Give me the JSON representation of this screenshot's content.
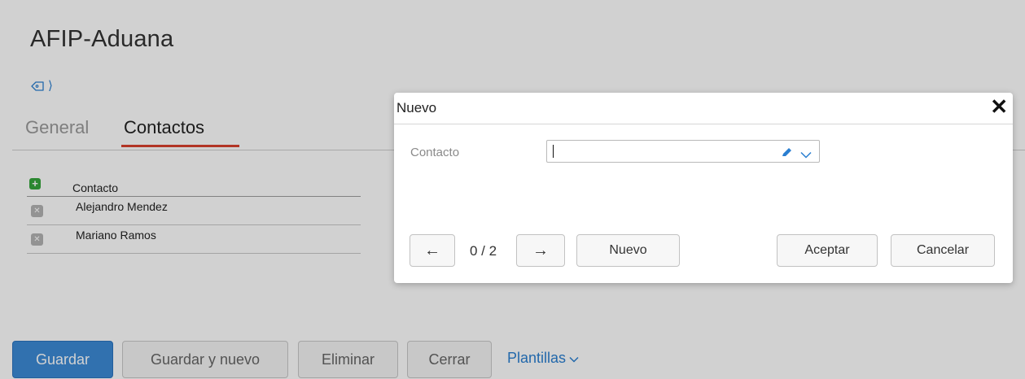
{
  "page": {
    "title": "AFIP-Aduana",
    "breadcrumb_icon": "tag-icon",
    "breadcrumb_chevron": "⟩"
  },
  "tabs": [
    {
      "label": "General",
      "active": false
    },
    {
      "label": "Contactos",
      "active": true
    }
  ],
  "contacts_grid": {
    "add_icon": "plus-icon",
    "column_header": "Contacto",
    "rows": [
      {
        "name": "Alejandro Mendez"
      },
      {
        "name": "Mariano Ramos"
      }
    ]
  },
  "footer": {
    "save_label": "Guardar",
    "save_new_label": "Guardar y nuevo",
    "delete_label": "Eliminar",
    "close_label": "Cerrar",
    "templates_label": "Plantillas"
  },
  "dialog": {
    "title": "Nuevo",
    "close_glyph": "✕",
    "field_label": "Contacto",
    "field_value": "",
    "prev_glyph": "←",
    "next_glyph": "→",
    "counter": "0 / 2",
    "new_label": "Nuevo",
    "accept_label": "Aceptar",
    "cancel_label": "Cancelar"
  },
  "colors": {
    "primary": "#3c8ad6",
    "link": "#2a7fd1",
    "tab_accent": "#d9412e",
    "add_green": "#35a53b"
  }
}
